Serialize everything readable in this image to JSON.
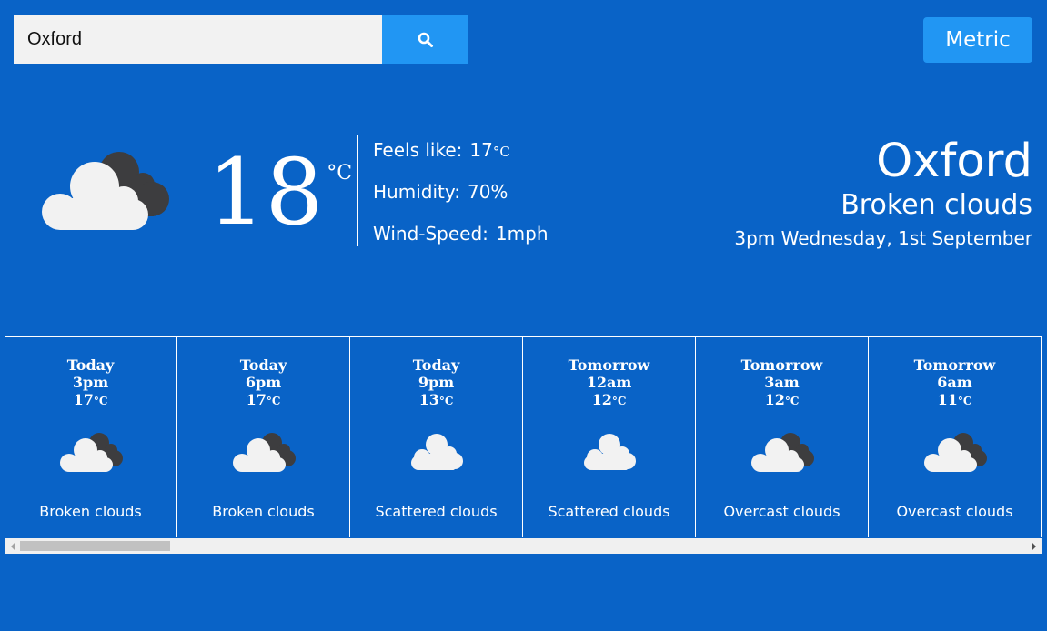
{
  "search": {
    "value": "Oxford",
    "icon": "search-icon"
  },
  "unit_toggle": {
    "label": "Metric"
  },
  "current": {
    "temperature": "18",
    "unit": "°C",
    "icon": "broken-clouds-icon",
    "feels_like_label": "Feels like:",
    "feels_like_value": "17",
    "feels_like_unit": "°C",
    "humidity_label": "Humidity:",
    "humidity_value": "70%",
    "wind_label": "Wind-Speed:",
    "wind_value": "1mph",
    "city": "Oxford",
    "description": "Broken clouds",
    "datetime": "3pm Wednesday, 1st September"
  },
  "forecast": [
    {
      "day": "Today",
      "time": "3pm",
      "temp": "17",
      "unit": "°C",
      "icon": "broken-clouds-icon",
      "description": "Broken clouds"
    },
    {
      "day": "Today",
      "time": "6pm",
      "temp": "17",
      "unit": "°C",
      "icon": "broken-clouds-icon",
      "description": "Broken clouds"
    },
    {
      "day": "Today",
      "time": "9pm",
      "temp": "13",
      "unit": "°C",
      "icon": "scattered-clouds-icon",
      "description": "Scattered clouds"
    },
    {
      "day": "Tomorrow",
      "time": "12am",
      "temp": "12",
      "unit": "°C",
      "icon": "scattered-clouds-icon",
      "description": "Scattered clouds"
    },
    {
      "day": "Tomorrow",
      "time": "3am",
      "temp": "12",
      "unit": "°C",
      "icon": "overcast-clouds-icon",
      "description": "Overcast clouds"
    },
    {
      "day": "Tomorrow",
      "time": "6am",
      "temp": "11",
      "unit": "°C",
      "icon": "overcast-clouds-icon",
      "description": "Overcast clouds"
    }
  ],
  "colors": {
    "background": "#0963c7",
    "accent": "#2196f3",
    "cloud_light": "#f2f2f2",
    "cloud_dark": "#3d3d3f"
  }
}
